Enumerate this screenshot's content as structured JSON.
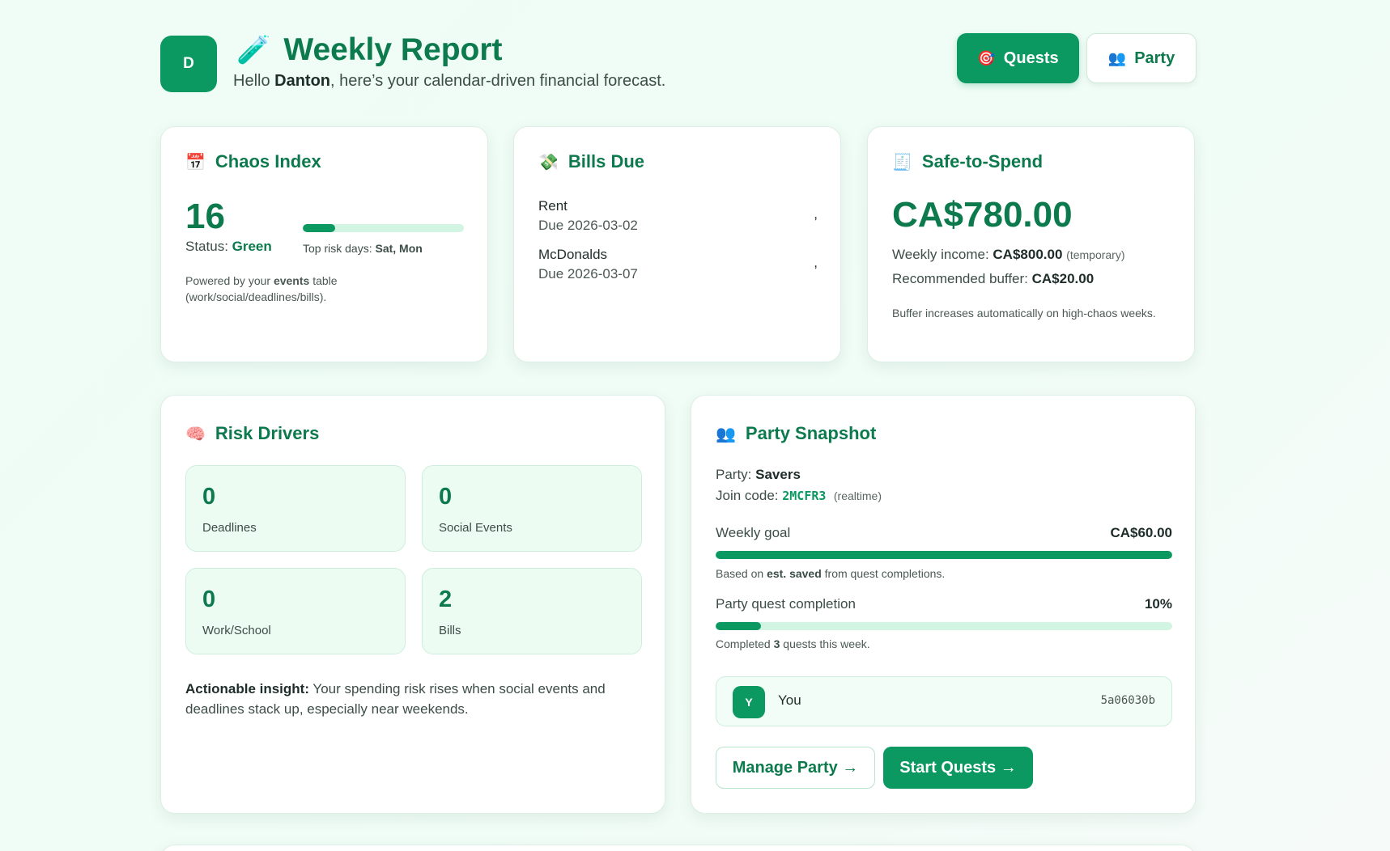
{
  "header": {
    "avatar_letter": "D",
    "title_icon": "test-tube-icon",
    "title": "Weekly Report",
    "subtitle_prefix": "Hello ",
    "user_name": "Danton",
    "subtitle_suffix": ", here’s your calendar-driven financial forecast.",
    "quests_icon": "target-icon",
    "quests_label": "Quests",
    "party_icon": "people-icon",
    "party_label": "Party"
  },
  "chaos": {
    "icon": "calendar-icon",
    "title": "Chaos Index",
    "value": "16",
    "bar_fraction": 0.2,
    "status_label": "Status: ",
    "status_value": "Green",
    "risk_label": "Top risk days: ",
    "risk_days": "Sat, Mon",
    "note_prefix": "Powered by your ",
    "note_bold": "events",
    "note_suffix": " table (work/social/deadlines/bills)."
  },
  "bills": {
    "icon": "money-icon",
    "title": "Bills Due",
    "items": [
      {
        "name": "Rent",
        "due": "Due 2026-03-02",
        "amount": ","
      },
      {
        "name": "McDonalds",
        "due": "Due 2026-03-07",
        "amount": ","
      }
    ]
  },
  "safe": {
    "icon": "receipt-icon",
    "title": "Safe-to-Spend",
    "value": "CA$780.00",
    "income_label": "Weekly income: ",
    "income_value": "CA$800.00",
    "income_note": "(temporary)",
    "buffer_label": "Recommended buffer: ",
    "buffer_value": "CA$20.00",
    "note": "Buffer increases automatically on high-chaos weeks."
  },
  "risk": {
    "icon": "brain-icon",
    "title": "Risk Drivers",
    "tiles": [
      {
        "value": "0",
        "label": "Deadlines"
      },
      {
        "value": "0",
        "label": "Social Events"
      },
      {
        "value": "0",
        "label": "Work/School"
      },
      {
        "value": "2",
        "label": "Bills"
      }
    ],
    "insight_label": "Actionable insight:",
    "insight_text": " Your spending risk rises when social events and deadlines stack up, especially near weekends."
  },
  "party": {
    "icon": "people-icon",
    "title": "Party Snapshot",
    "party_label": "Party: ",
    "party_name": "Savers",
    "join_label": "Join code: ",
    "join_code": "2MCFR3",
    "join_note": "(realtime)",
    "goal_label": "Weekly goal",
    "goal_value": "CA$60.00",
    "goal_fraction": 1.0,
    "goal_note_prefix": "Based on ",
    "goal_note_bold": "est. saved",
    "goal_note_suffix": " from quest completions.",
    "completion_label": "Party quest completion",
    "completion_value": "10%",
    "completion_fraction": 0.1,
    "completed_prefix": "Completed ",
    "completed_count": "3",
    "completed_suffix": " quests this week.",
    "member": {
      "initial": "Y",
      "name": "You",
      "id": "5a06030b"
    },
    "manage_label": "Manage Party →",
    "start_label": "Start Quests →"
  },
  "colors": {
    "accent": "#0b9961",
    "accent_dark": "#0c7a4d",
    "track": "#d2f4e2",
    "background": "#effdf6"
  }
}
